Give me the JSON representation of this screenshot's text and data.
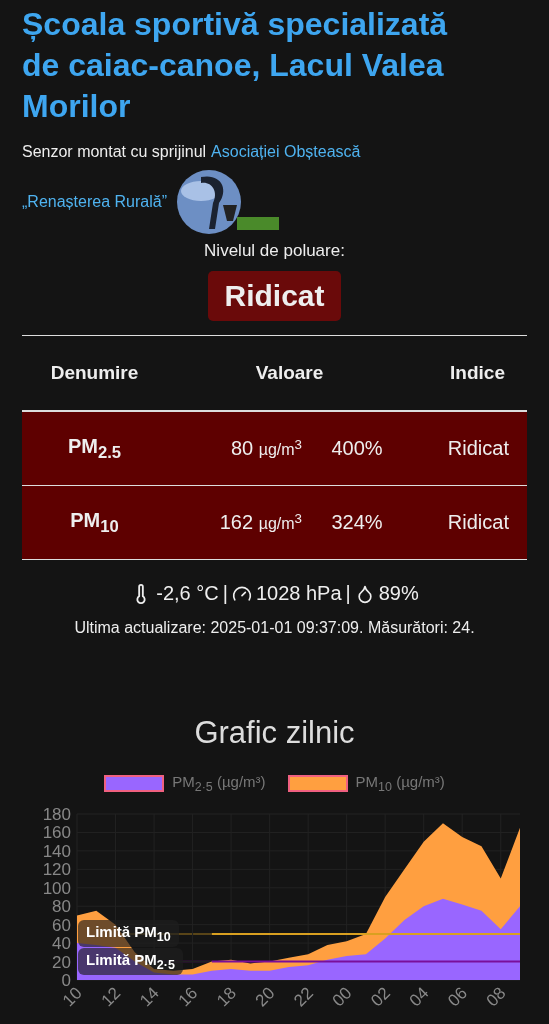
{
  "title": "Școala sportivă specializată de caiac-canoe, Lacul Valea Morilor",
  "sponsor": {
    "text": "Senzor montat cu sprijinul",
    "link": [
      "Asociației Obștească",
      "„Renașterea Rurală”"
    ]
  },
  "pollution": {
    "label": "Nivelul de poluare:",
    "level": "Ridicat",
    "color": "#6a0a0a"
  },
  "table": {
    "columns": [
      "Denumire",
      "Valoare",
      "Indice"
    ],
    "rows": [
      {
        "name": "PM$_{2.5}$",
        "value": "80",
        "unit": "µg/m$^{3}$",
        "percent": "400%",
        "index": "Ridicat",
        "color": "#5e0000"
      },
      {
        "name": "PM$_{10}$",
        "value": "162",
        "unit": "µg/m$^{3}$",
        "percent": "324%",
        "index": "Ridicat",
        "color": "#5e0000"
      }
    ]
  },
  "weather": [
    {
      "kind": "temperature",
      "text": "-2,6 °C"
    },
    {
      "kind": "separator",
      "text": "|"
    },
    {
      "kind": "pressure",
      "text": "1028 hPa"
    },
    {
      "kind": "separator",
      "text": "|"
    },
    {
      "kind": "humidity",
      "text": "89%"
    }
  ],
  "updated": "Ultima actualizare: 2025-01-01 09:37:09. Măsurători: 24.",
  "chart": {
    "heading": "Grafic zilnic",
    "chart_data": {
      "type": "area",
      "categories": [
        "10",
        null,
        "12",
        null,
        "14",
        null,
        "16",
        null,
        "18",
        null,
        "20",
        null,
        "22",
        null,
        "00",
        null,
        "02",
        null,
        "04",
        null,
        "06",
        null,
        "08",
        null
      ],
      "grid": true,
      "series": [
        {
          "name": "PM$_{2·5}$ (µg/m³)",
          "color": "#9966ff",
          "values": [
            40,
            38,
            35,
            20,
            8,
            6,
            6,
            10,
            12,
            10,
            10,
            14,
            16,
            22,
            26,
            28,
            45,
            65,
            80,
            88,
            82,
            75,
            55,
            80
          ]
        },
        {
          "name": "PM$_{10}$ (µg/m³)",
          "color": "#ff9f40",
          "values": [
            70,
            75,
            60,
            30,
            12,
            10,
            12,
            20,
            22,
            18,
            20,
            24,
            28,
            38,
            42,
            50,
            90,
            120,
            150,
            170,
            155,
            145,
            110,
            165
          ]
        },
        {
          "name": "Limită PM$_{10}$",
          "type": "line",
          "color": "#d9a020",
          "values": [
            null,
            null,
            null,
            null,
            null,
            null,
            null,
            50,
            50,
            50,
            50,
            50,
            50,
            50,
            50,
            50,
            50,
            50,
            50,
            50,
            50,
            50,
            50,
            50
          ]
        },
        {
          "name": "Limită PM$_{2·5}$",
          "type": "line",
          "color": "#7a0f9a",
          "values": [
            null,
            null,
            null,
            null,
            null,
            null,
            null,
            20,
            20,
            20,
            20,
            20,
            20,
            20,
            20,
            20,
            20,
            20,
            20,
            20,
            20,
            20,
            20,
            20
          ]
        }
      ],
      "ylim": [
        0,
        180
      ],
      "yticks": [
        0,
        20,
        40,
        60,
        80,
        100,
        120,
        140,
        160,
        180
      ]
    }
  }
}
